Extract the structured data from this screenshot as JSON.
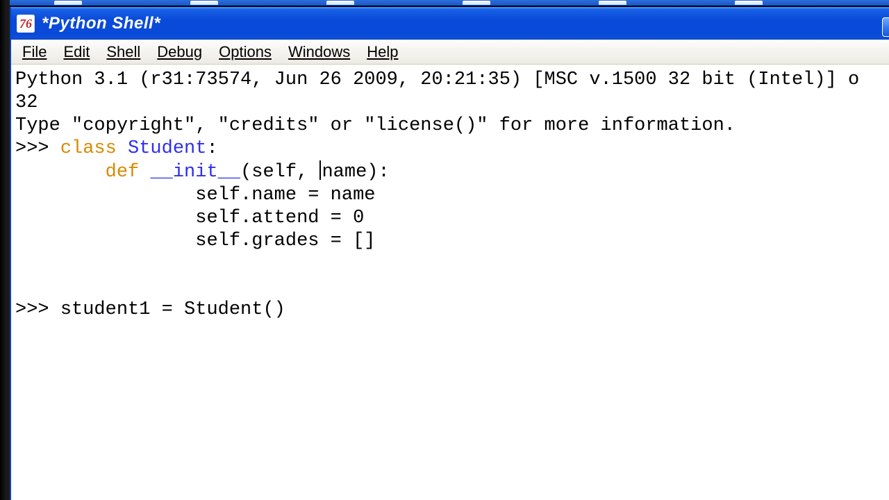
{
  "window": {
    "title": "*Python Shell*",
    "icon_label": "76"
  },
  "menus": {
    "file": "File",
    "edit": "Edit",
    "shell": "Shell",
    "debug": "Debug",
    "options": "Options",
    "windows": "Windows",
    "help": "Help"
  },
  "shell": {
    "banner_l1": "Python 3.1 (r31:73574, Jun 26 2009, 20:21:35) [MSC v.1500 32 bit (Intel)] o",
    "banner_l2": "32",
    "banner_l3": "Type \"copyright\", \"credits\" or \"license()\" for more information.",
    "p1": ">>> ",
    "kw_class": "class",
    "sp": " ",
    "name_student": "Student",
    "colon": ":",
    "indent1": "        ",
    "kw_def": "def",
    "dunder_init": "__init__",
    "sig_pre": "(self, ",
    "sig_post": "name):",
    "indent2": "                ",
    "body_l1": "self.name = name",
    "body_l2": "self.attend = 0",
    "body_l3": "self.grades = []",
    "blank": "",
    "p2_line": "student1 = Student()"
  }
}
